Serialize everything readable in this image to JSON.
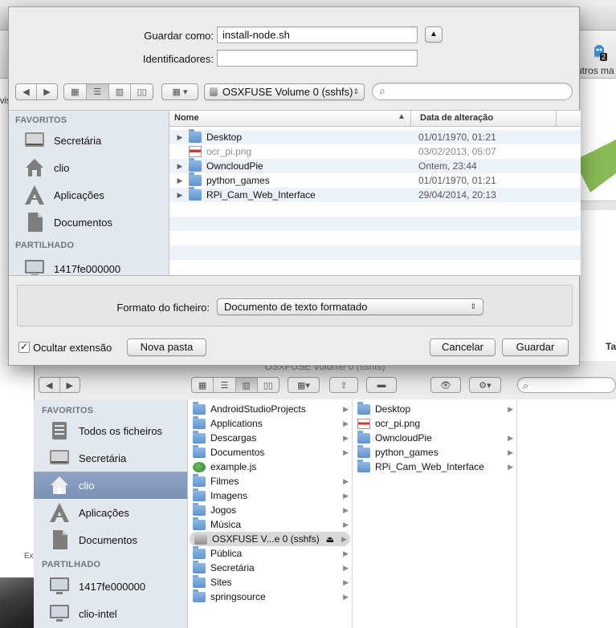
{
  "background": {
    "others_label": "utros ma",
    "ghost_badge": "2",
    "left_letter": "vis",
    "right_tab_label": "Ta",
    "small_tab_label": "Ex"
  },
  "dialog": {
    "save_as_label": "Guardar como:",
    "save_as_value": "install-node.sh",
    "tags_label": "Identificadores:",
    "tags_value": "",
    "location": "OSXFUSE Volume 0 (sshfs)",
    "search_placeholder": "",
    "sidebar": {
      "favorites_heading": "FAVORITOS",
      "favorites": [
        {
          "label": "Secretária",
          "icon": "desktop-icon"
        },
        {
          "label": "clio",
          "icon": "home-icon"
        },
        {
          "label": "Aplicações",
          "icon": "applications-icon"
        },
        {
          "label": "Documentos",
          "icon": "documents-icon"
        }
      ],
      "shared_heading": "PARTILHADO",
      "shared": [
        {
          "label": "1417fe000000",
          "icon": "monitor-icon"
        }
      ]
    },
    "columns": {
      "name": "Nome",
      "date": "Data de alteração"
    },
    "files": [
      {
        "name": "Desktop",
        "date": "01/01/1970, 01:21",
        "kind": "folder",
        "dim": false
      },
      {
        "name": "ocr_pi.png",
        "date": "03/02/2013, 05:07",
        "kind": "image",
        "dim": true
      },
      {
        "name": "OwncloudPie",
        "date": "Ontem, 23:44",
        "kind": "folder",
        "dim": false
      },
      {
        "name": "python_games",
        "date": "01/01/1970, 01:21",
        "kind": "folder",
        "dim": false
      },
      {
        "name": "RPi_Cam_Web_Interface",
        "date": "29/04/2014, 20:13",
        "kind": "folder",
        "dim": false
      }
    ],
    "format_label": "Formato do ficheiro:",
    "format_value": "Documento de texto formatado",
    "hide_extension_label": "Ocultar extensão",
    "hide_extension_checked": true,
    "new_folder_label": "Nova pasta",
    "cancel_label": "Cancelar",
    "save_label": "Guardar"
  },
  "finder": {
    "title": "OSXFUSE Volume 0 (sshfs)",
    "sidebar": {
      "favorites_heading": "FAVORITOS",
      "favorites": [
        {
          "label": "Todos os ficheiros",
          "icon": "all-files-icon",
          "selected": false
        },
        {
          "label": "Secretária",
          "icon": "desktop-icon",
          "selected": false
        },
        {
          "label": "clio",
          "icon": "home-icon",
          "selected": true
        },
        {
          "label": "Aplicações",
          "icon": "applications-icon",
          "selected": false
        },
        {
          "label": "Documentos",
          "icon": "documents-icon",
          "selected": false
        }
      ],
      "shared_heading": "PARTILHADO",
      "shared": [
        {
          "label": "1417fe000000",
          "icon": "monitor-icon"
        },
        {
          "label": "clio-intel",
          "icon": "monitor-icon"
        }
      ]
    },
    "column1": [
      {
        "label": "AndroidStudioProjects",
        "kind": "folder",
        "arrow": true
      },
      {
        "label": "Applications",
        "kind": "folder",
        "arrow": true
      },
      {
        "label": "Descargas",
        "kind": "folder",
        "arrow": true
      },
      {
        "label": "Documentos",
        "kind": "folder",
        "arrow": true
      },
      {
        "label": "example.js",
        "kind": "js",
        "arrow": false
      },
      {
        "label": "Filmes",
        "kind": "folder",
        "arrow": true
      },
      {
        "label": "Imagens",
        "kind": "folder",
        "arrow": true
      },
      {
        "label": "Jogos",
        "kind": "folder",
        "arrow": true
      },
      {
        "label": "Música",
        "kind": "folder",
        "arrow": true
      },
      {
        "label": "OSXFUSE V...e 0 (sshfs)",
        "kind": "drive",
        "arrow": true,
        "highlight": true
      },
      {
        "label": "Pública",
        "kind": "folder",
        "arrow": true
      },
      {
        "label": "Secretária",
        "kind": "folder",
        "arrow": true
      },
      {
        "label": "Sites",
        "kind": "folder",
        "arrow": true
      },
      {
        "label": "springsource",
        "kind": "folder",
        "arrow": true
      }
    ],
    "column2": [
      {
        "label": "Desktop",
        "kind": "folder",
        "arrow": true
      },
      {
        "label": "ocr_pi.png",
        "kind": "image",
        "arrow": false
      },
      {
        "label": "OwncloudPie",
        "kind": "folder",
        "arrow": true
      },
      {
        "label": "python_games",
        "kind": "folder",
        "arrow": true
      },
      {
        "label": "RPi_Cam_Web_Interface",
        "kind": "folder",
        "arrow": true
      }
    ]
  },
  "colors": {
    "sidebar_bg": "#e3e8ee",
    "selection": "#7c91b6",
    "folder": "#6b9dd6"
  }
}
